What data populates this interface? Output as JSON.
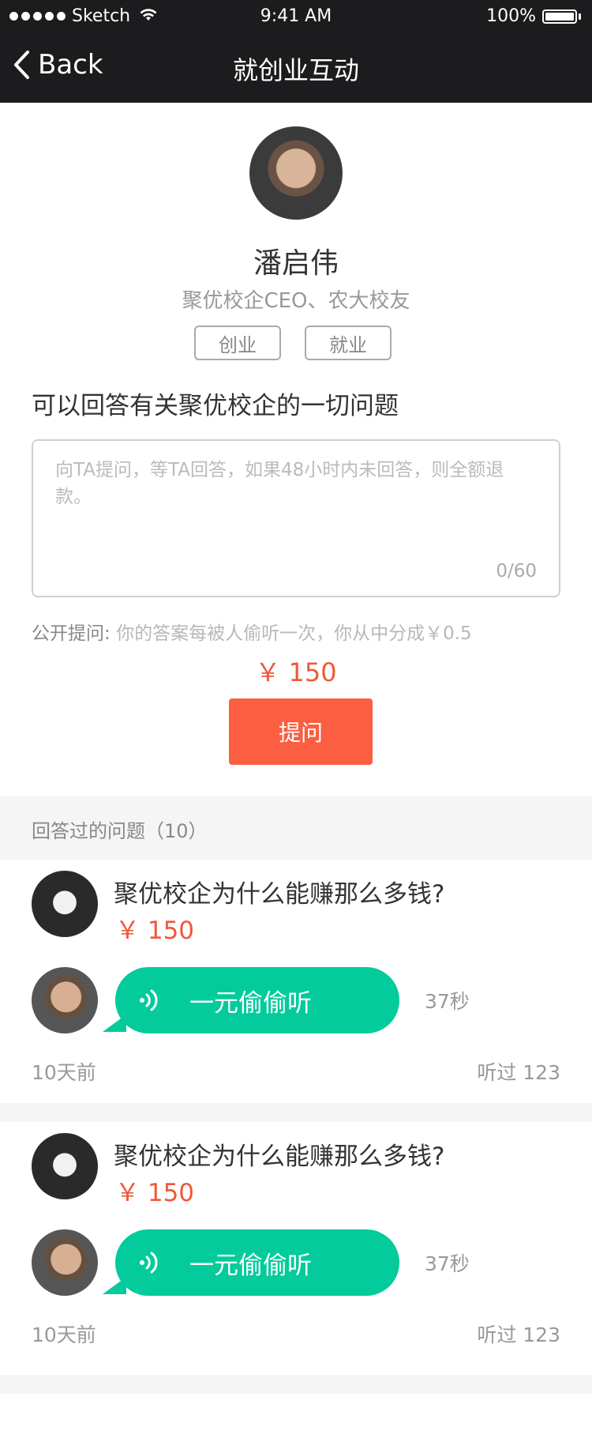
{
  "status_bar": {
    "carrier": "Sketch",
    "time": "9:41 AM",
    "battery": "100%"
  },
  "nav": {
    "back_label": "Back",
    "title": "就创业互动"
  },
  "profile": {
    "name": "潘启伟",
    "subtitle": "聚优校企CEO、农大校友",
    "tags": [
      "创业",
      "就业"
    ]
  },
  "ask": {
    "headline": "可以回答有关聚优校企的一切问题",
    "placeholder": "向TA提问，等TA回答，如果48小时内未回答，则全额退款。",
    "counter": "0/60",
    "public_label": "公开提问:",
    "public_desc": "你的答案每被人偷听一次，你从中分成￥0.5",
    "price": "￥ 150",
    "button_label": "提问"
  },
  "answered": {
    "header": "回答过的问题（10）",
    "items": [
      {
        "question": "聚优校企为什么能赚那么多钱?",
        "price": "￥ 150",
        "listen_label": "一元偷偷听",
        "duration": "37秒",
        "time_ago": "10天前",
        "heard": "听过 123"
      },
      {
        "question": "聚优校企为什么能赚那么多钱?",
        "price": "￥ 150",
        "listen_label": "一元偷偷听",
        "duration": "37秒",
        "time_ago": "10天前",
        "heard": "听过 123"
      }
    ]
  },
  "colors": {
    "accent": "#fb5e40",
    "price": "#f0583a",
    "listen_bubble": "#04cb9b",
    "nav_bg": "#1c1c1e"
  },
  "icons": [
    "signal-dots-icon",
    "wifi-icon",
    "battery-icon",
    "back-chevron-icon",
    "sound-wave-icon"
  ]
}
